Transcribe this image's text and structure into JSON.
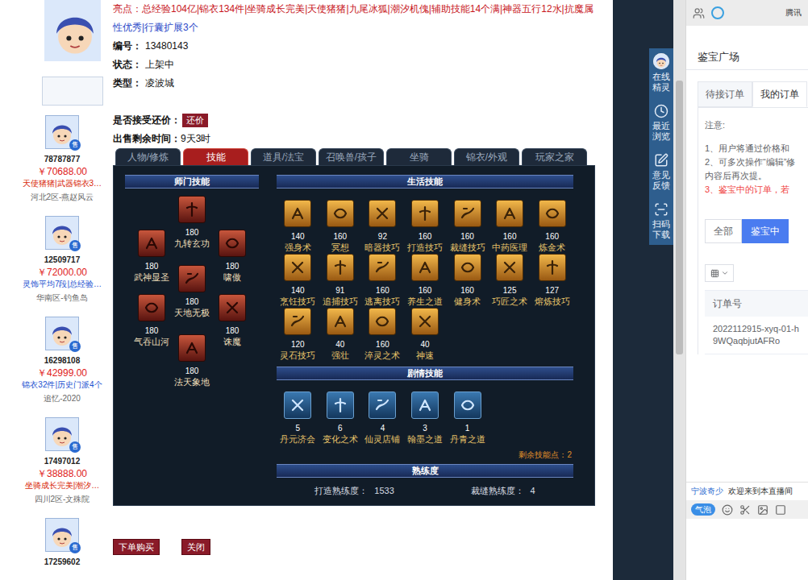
{
  "listing": {
    "highlights": [
      {
        "text": "亮点：总经验104亿|锦衣134件|坐骑成长完美|天使猪猪|九尾冰狐|潮汐机傀|辅助技能14个满|神器五行12水|抗魔属",
        "color": "#c8161d"
      },
      {
        "text": "性优秀|行囊扩展3个",
        "color": "#2a48c8"
      }
    ],
    "fields": [
      {
        "label": "编号：",
        "value": "13480143"
      },
      {
        "label": "状态：",
        "value": "上架中"
      },
      {
        "label": "类型：",
        "value": "凌波城"
      }
    ],
    "bargain": {
      "label": "是否接受还价：",
      "button": "还价"
    },
    "remaining_time": {
      "label": "出售剩余时间：",
      "value": "9天3时"
    }
  },
  "tabs": [
    {
      "label": "人物/修炼",
      "selected": false
    },
    {
      "label": "技能",
      "selected": true
    },
    {
      "label": "道具/法宝",
      "selected": false
    },
    {
      "label": "召唤兽/孩子",
      "selected": false
    },
    {
      "label": "坐骑",
      "selected": false
    },
    {
      "label": "锦衣/外观",
      "selected": false
    },
    {
      "label": "玩家之家",
      "selected": false
    }
  ],
  "sect_skills": {
    "title": "师门技能",
    "columns": [
      [
        {
          "name": "武神显圣",
          "level": "180"
        },
        {
          "name": "气吞山河",
          "level": "180"
        }
      ],
      [
        {
          "name": "九转玄功",
          "level": "180"
        },
        {
          "name": "天地无极",
          "level": "180"
        },
        {
          "name": "法天象地",
          "level": "180"
        }
      ],
      [
        {
          "name": "啸傲",
          "level": "180"
        },
        {
          "name": "诛魔",
          "level": "180"
        }
      ]
    ]
  },
  "life_skills": {
    "title": "生活技能",
    "skills": [
      {
        "name": "强身术",
        "level": "140"
      },
      {
        "name": "冥想",
        "level": "160"
      },
      {
        "name": "暗器技巧",
        "level": "92"
      },
      {
        "name": "打造技巧",
        "level": "160"
      },
      {
        "name": "裁缝技巧",
        "level": "160"
      },
      {
        "name": "中药医理",
        "level": "160"
      },
      {
        "name": "炼金术",
        "level": "160"
      },
      {
        "name": "烹饪技巧",
        "level": "140"
      },
      {
        "name": "追捕技巧",
        "level": "91"
      },
      {
        "name": "逃离技巧",
        "level": "160"
      },
      {
        "name": "养生之道",
        "level": "160"
      },
      {
        "name": "健身术",
        "level": "160"
      },
      {
        "name": "巧匠之术",
        "level": "125"
      },
      {
        "name": "熔炼技巧",
        "level": "127"
      },
      {
        "name": "灵石技巧",
        "level": "120"
      },
      {
        "name": "强壮",
        "level": "40"
      },
      {
        "name": "淬灵之术",
        "level": "160"
      },
      {
        "name": "神速",
        "level": "40"
      }
    ]
  },
  "plot_skills": {
    "title": "剧情技能",
    "skills": [
      {
        "name": "丹元济会",
        "level": "5"
      },
      {
        "name": "变化之术",
        "level": "6"
      },
      {
        "name": "仙灵店铺",
        "level": "4"
      },
      {
        "name": "翰墨之道",
        "level": "3"
      },
      {
        "name": "丹青之道",
        "level": "1"
      }
    ],
    "remaining": "剩余技能点：2"
  },
  "proficiency": {
    "title": "熟练度",
    "items": [
      {
        "label": "打造熟练度：",
        "value": "1533"
      },
      {
        "label": "裁缝熟练度：",
        "value": "4"
      }
    ]
  },
  "actions": [
    "下单购买",
    "关闭"
  ],
  "similar": [
    {
      "id": "78787877",
      "badge": "售",
      "price": "￥70688.00",
      "tag": "天使猪猪|武器锦衣3…",
      "tag_color": "#d81e06",
      "server": "河北2区-燕赵风云"
    },
    {
      "id": "12509717",
      "badge": "售",
      "price": "￥72000.00",
      "tag": "灵饰平均7段|总经验…",
      "tag_color": "#1a4fd0",
      "server": "华南区-钓鱼岛"
    },
    {
      "id": "16298108",
      "badge": "售",
      "price": "￥42999.00",
      "tag": "锦衣32件|历史门派4个",
      "tag_color": "#1a4fd0",
      "server": "追忆-2020"
    },
    {
      "id": "17497012",
      "badge": "售",
      "price": "￥38888.00",
      "tag": "坐骑成长完美|潮汐…",
      "tag_color": "#d81e06",
      "server": "四川2区-文殊院"
    },
    {
      "id": "17259602",
      "badge": "售"
    }
  ],
  "side_toolbar": [
    {
      "label": "在线精灵",
      "kind": "avatar"
    },
    {
      "label": "最近浏览",
      "kind": "clock"
    },
    {
      "label": "意见反馈",
      "kind": "feedback"
    },
    {
      "label": "扫码下载",
      "kind": "scan"
    }
  ],
  "top_bar": {
    "text": "腾讯"
  },
  "appraisal": {
    "title": "鉴宝广场",
    "tabs": [
      {
        "label": "待接订单",
        "selected": false
      },
      {
        "label": "我的订单",
        "selected": true
      }
    ],
    "notice_title": "注意:",
    "notices": [
      {
        "text": "1、用户将通过价格和",
        "color": "#606266"
      },
      {
        "text": "2、可多次操作“编辑”修",
        "color": "#606266"
      },
      {
        "text": "内容后再次提。",
        "color": "#606266"
      },
      {
        "text": "3、鉴宝中的订单，若",
        "color": "#f04040"
      }
    ],
    "filters": [
      {
        "label": "全部",
        "selected": false
      },
      {
        "label": "鉴宝中",
        "selected": true
      }
    ],
    "table": {
      "columns": [
        "订单号"
      ],
      "rows": [
        [
          "2022112915-xyq-01-h9WQaqbjutAFRo"
        ]
      ]
    }
  },
  "chat": {
    "user": "宁波奇少",
    "message": "欢迎来到本直播间",
    "toolbar_label": "气泡"
  }
}
